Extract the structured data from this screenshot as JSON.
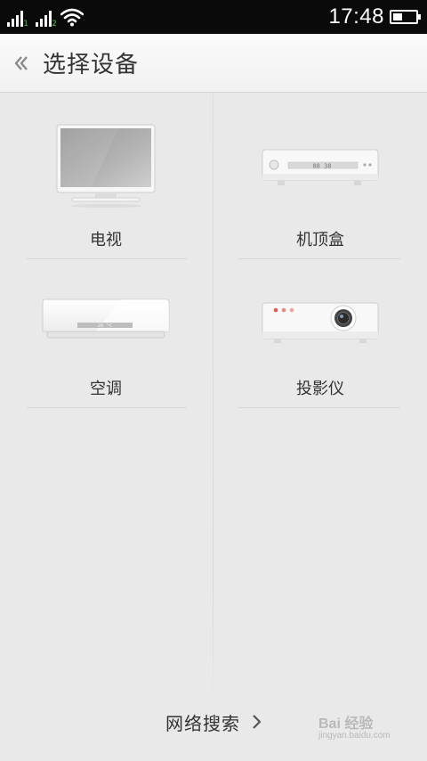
{
  "status_bar": {
    "sim1_tag": "1",
    "sim2_tag": "2",
    "time": "17:48",
    "battery_level": 0.4
  },
  "header": {
    "back_icon": "chevron-left-icon",
    "title": "选择设备"
  },
  "devices": [
    {
      "label": "电视",
      "icon": "tv-icon"
    },
    {
      "label": "机顶盒",
      "icon": "set-top-box-icon",
      "display": "88 38"
    },
    {
      "label": "空调",
      "icon": "air-conditioner-icon",
      "display": "26 °C"
    },
    {
      "label": "投影仪",
      "icon": "projector-icon"
    }
  ],
  "footer": {
    "search_label": "网络搜索",
    "arrow_icon": "chevron-right-icon"
  },
  "watermark": {
    "logo": "Bai 经验",
    "url": "jingyan.baidu.com"
  },
  "colors": {
    "status_bar": "#0a0a0a",
    "background": "#e9e9e9",
    "projector_dots": "#e05a4e"
  }
}
